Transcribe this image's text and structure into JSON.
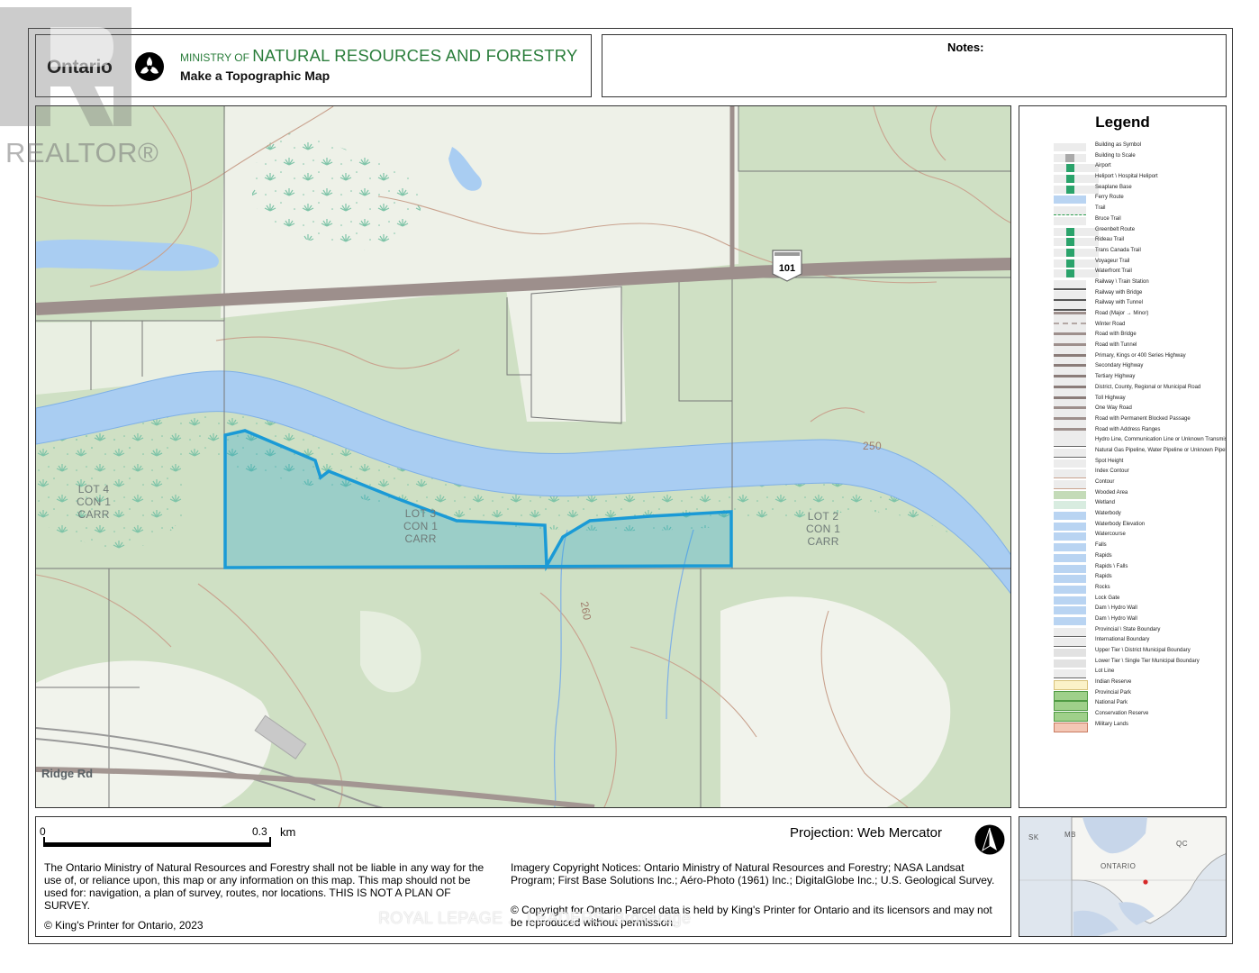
{
  "header": {
    "brand": "Ontario",
    "ministry_prefix": "MINISTRY OF ",
    "ministry_name": "NATURAL RESOURCES AND FORESTRY",
    "subtitle": "Make a Topographic Map",
    "brand_color": "#2a7d3b"
  },
  "notes": {
    "label": "Notes:"
  },
  "map": {
    "lots": [
      {
        "line1": "LOT 4",
        "line2": "CON 1",
        "line3": "CARR"
      },
      {
        "line1": "LOT 3",
        "line2": "CON 1",
        "line3": "CARR"
      },
      {
        "line1": "LOT 2",
        "line2": "CON 1",
        "line3": "CARR"
      }
    ],
    "contours": [
      "250",
      "260"
    ],
    "highway_shield": "101",
    "road_name": "Ridge Rd",
    "colors": {
      "water": "#a9cdf2",
      "woods": "#c8dbbd",
      "open": "#f1f3ec",
      "parcel": "#1a9ad6",
      "road": "#9a8a88",
      "contour": "#c9a28e"
    }
  },
  "legend": {
    "title": "Legend",
    "items": [
      "Building as Symbol",
      "Building to Scale",
      "Airport",
      "Heliport \\ Hospital Heliport",
      "Seaplane Base",
      "Ferry Route",
      "Trail",
      "Bruce Trail",
      "Greenbelt Route",
      "Rideau Trail",
      "Trans Canada Trail",
      "Voyageur Trail",
      "Waterfront Trail",
      "Railway \\ Train Station",
      "Railway with Bridge",
      "Railway with Tunnel",
      "Road (Major → Minor)",
      "Winter Road",
      "Road with Bridge",
      "Road with Tunnel",
      "Primary, Kings or 400 Series Highway",
      "Secondary Highway",
      "Tertiary Highway",
      "District, County, Regional or Municipal Road",
      "Toll Highway",
      "One Way Road",
      "Road with Permanent Blocked Passage",
      "Road with Address Ranges",
      "Hydro Line, Communication Line or Unknown Transmission Line",
      "Natural Gas Pipeline, Water Pipeline or Unknown Pipeline",
      "Spot Height",
      "Index Contour",
      "Contour",
      "Wooded Area",
      "Wetland",
      "Waterbody",
      "Waterbody Elevation",
      "Watercourse",
      "Falls",
      "Rapids",
      "Rapids \\ Falls",
      "Rapids",
      "Rocks",
      "Lock Gate",
      "Dam \\ Hydro Wall",
      "Dam \\ Hydro Wall",
      "Provincial \\ State Boundary",
      "International Boundary",
      "Upper Tier \\ District Municipal Boundary",
      "Lower Tier \\ Single Tier Municipal Boundary",
      "Lot Line",
      "Indian Reserve",
      "Provincial Park",
      "National Park",
      "Conservation Reserve",
      "Military Lands"
    ]
  },
  "footer": {
    "scale_start": "0",
    "scale_end": "0.3",
    "scale_unit": "km",
    "projection": "Projection: Web Mercator",
    "disclaimer": "The Ontario Ministry of Natural Resources and Forestry shall not be liable in any way for the use of, or reliance upon, this map or any information on this map.  This map should not be used for: navigation, a plan of survey, routes, nor locations. THIS IS NOT A PLAN OF SURVEY.",
    "copyright": "© King's Printer for Ontario,  2023",
    "imagery": "Imagery Copyright Notices: Ontario Ministry of Natural Resources and Forestry; NASA Landsat Program; First Base Solutions Inc.; Aéro-Photo (1961) Inc.; DigitalGlobe Inc.; U.S. Geological Survey.",
    "parcel": "© Copyright for Ontario Parcel data is held by King's Printer for Ontario and its licensors and may not be reproduced without permission."
  },
  "inset": {
    "labels": [
      "SK",
      "MB",
      "QC",
      "ONTARIO"
    ]
  },
  "watermarks": {
    "realtor": "REALTOR®",
    "brokerage": "ROYAL LEPAGE ... LEADERS, Brokerage"
  }
}
